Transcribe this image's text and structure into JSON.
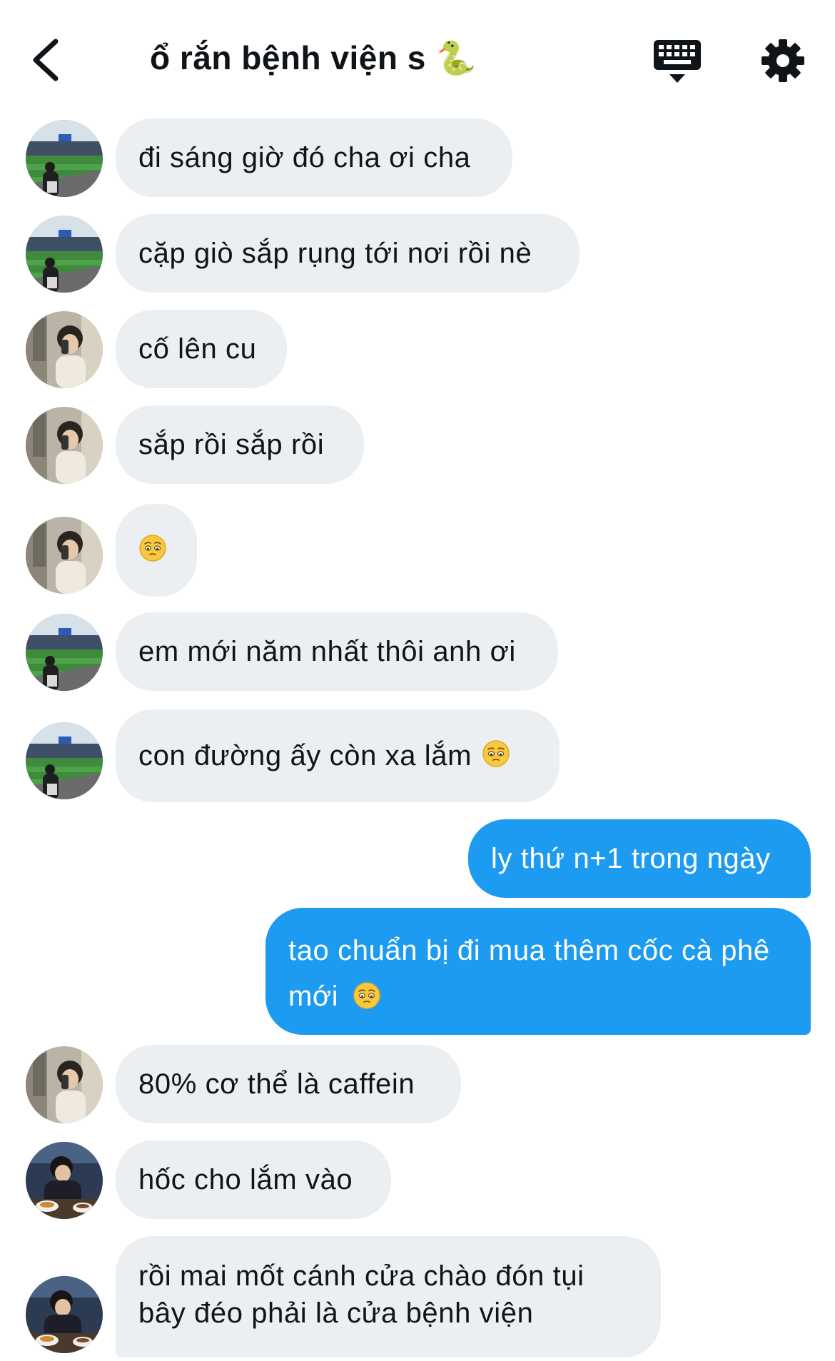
{
  "header": {
    "title": "ổ rắn bệnh viện s",
    "title_emoji": "🐍"
  },
  "colors": {
    "incoming_bubble": "#eceff2",
    "outgoing_bubble": "#1d9bf0",
    "text": "#0f1419"
  },
  "messages": [
    {
      "text": "đi sáng giờ đó cha ơi cha"
    },
    {
      "text": "cặp giò sắp rụng tới nơi rồi nè"
    },
    {
      "text": "cố lên cu"
    },
    {
      "text": "sắp rồi sắp rồi"
    },
    {
      "text": ""
    },
    {
      "text": "em mới năm nhất thôi anh ơi"
    },
    {
      "text": "con đường ấy còn xa lắm"
    },
    {
      "text": "ly thứ n+1 trong ngày"
    },
    {
      "text": "tao chuẩn bị đi mua thêm cốc cà phê mới"
    },
    {
      "text": "80% cơ thể là caffein"
    },
    {
      "text": "hốc cho lắm vào"
    },
    {
      "text": "rồi mai mốt cánh cửa chào đón tụi bây đéo phải là cửa bệnh viện"
    }
  ],
  "icons": {
    "back": "chevron-left-icon",
    "keyboard": "keyboard-icon",
    "settings": "gear-icon",
    "emoji": "pleading-face-icon"
  }
}
